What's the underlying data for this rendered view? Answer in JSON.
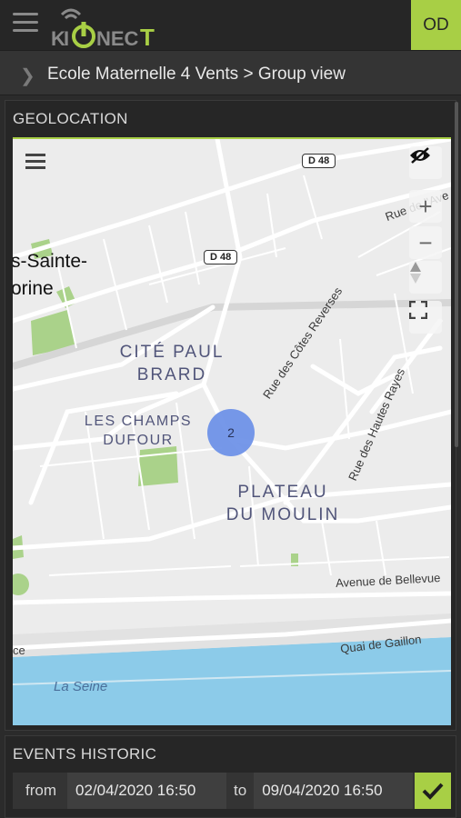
{
  "app": {
    "logo_text": "KIONECT",
    "avatar_initials": "OD",
    "accent": "#a8cf45"
  },
  "breadcrumb": {
    "text": "Ecole Maternelle 4 Vents > Group view"
  },
  "geolocation": {
    "title": "GEOLOCATION",
    "map": {
      "labels": {
        "town_line1": "s-Sainte-",
        "town_line2": "orine",
        "cite_paul_brard_1": "CITÉ PAUL",
        "cite_paul_brard_2": "BRARD",
        "champs_dufour_1": "LES CHAMPS",
        "champs_dufour_2": "DUFOUR",
        "plateau_1": "PLATEAU",
        "plateau_2": "DU MOULIN",
        "street_cotes_reverses": "Rue des Côtes Reverses",
        "street_hautes_rayes": "Rue des Hautes Rayes",
        "street_avenue_bellevue": "Avenue de Bellevue",
        "street_quai_gaillon": "Quai de Gaillon",
        "street_rue_de_lave": "Rue de l'Ave",
        "street_quai_fragment": "ce",
        "river": "La Seine",
        "road_d48_top": "D 48",
        "road_d48_mid": "D 48"
      },
      "cluster_count": "2",
      "controls": [
        "menu-icon",
        "eye-off-icon",
        "zoom-in-icon",
        "zoom-out-icon",
        "compass-icon",
        "fullscreen-icon"
      ]
    }
  },
  "events": {
    "title": "EVENTS HISTORIC",
    "from_label": "from",
    "from_value": "02/04/2020 16:50",
    "to_label": "to",
    "to_value": "09/04/2020 16:50",
    "confirm_icon": "check-icon"
  }
}
